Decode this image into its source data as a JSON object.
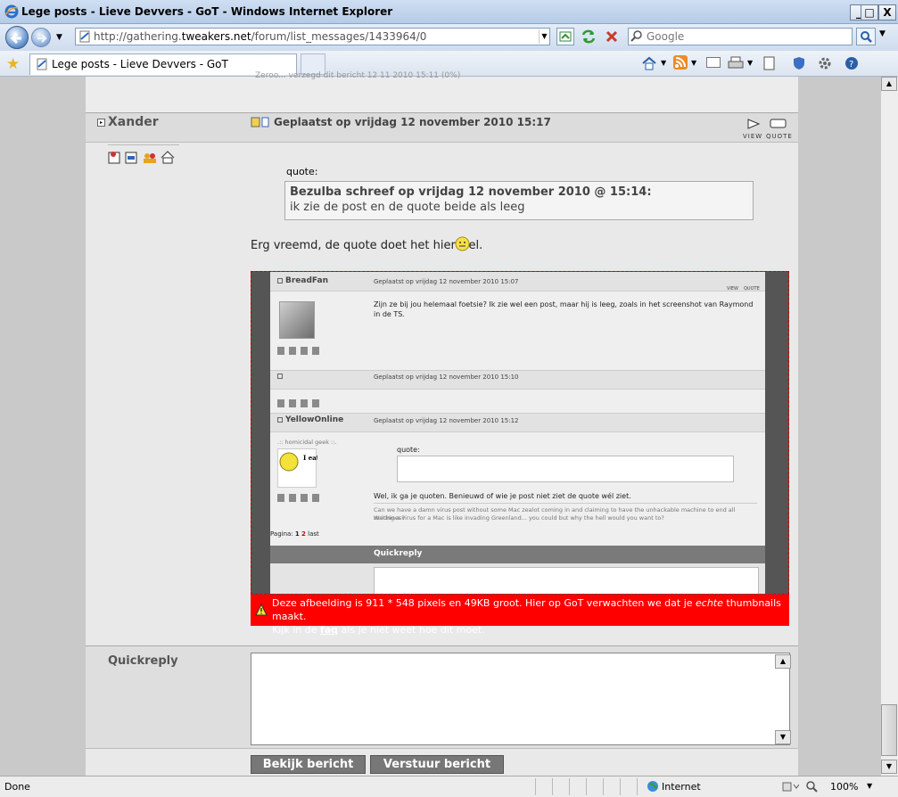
{
  "window": {
    "title": "Lege posts - Lieve Devvers - GoT - Windows Internet Explorer",
    "min": "_",
    "max": "□",
    "close": "X"
  },
  "addressbar": {
    "url_prefix": "http://gathering.",
    "url_domain": "tweakers.net",
    "url_path": "/forum/list_messages/1433964/0"
  },
  "searchbar": {
    "placeholder": "Google"
  },
  "tab": {
    "title": "Lege posts - Lieve Devvers - GoT"
  },
  "post": {
    "author": "Xander",
    "posted": "Geplaatst op vrijdag 12 november 2010 15:17",
    "view_label": "VIEW",
    "quote_label": "QUOTE",
    "quote_label_text": "quote:",
    "quote_header": "Bezulba schreef op vrijdag 12 november 2010 @ 15:14:",
    "quote_body": "ik zie de post en de quote beide als leeg",
    "message": "Erg vreemd, de quote doet het hier wel."
  },
  "screenshot": {
    "posts": [
      {
        "author": "BreadFan",
        "date": "Geplaatst op vrijdag 12 november 2010 15:07",
        "text": "Zijn ze bij jou helemaal foetsie? Ik zie wel een post, maar hij is leeg, zoals in het screenshot van Raymond in de TS."
      },
      {
        "author": "",
        "date": "Geplaatst op vrijdag 12 november 2010 15:10",
        "text": ""
      },
      {
        "author": "YellowOnline",
        "date": "Geplaatst op vrijdag 12 november 2010 15:12",
        "usertitle": ".:: homicidal geek ::.",
        "avatar_text": "I eat pussy",
        "quote_label": "quote:",
        "text": "Wel, ik ga je quoten. Benieuwd of wie je post niet ziet de quote wél ziet.",
        "sig1": "Can we have a damn virus post without some Mac zealot coming in and claiming to have the unhackable machine to end all machines?",
        "sig2": "Writing a virus for a Mac is like invading Greenland... you could but why the hell would you want to?"
      }
    ],
    "view": "VIEW",
    "quote": "QUOTE",
    "pagina": "Pagina:",
    "page1": "1",
    "page2": "2",
    "last": "last",
    "quickreply": "Quickreply",
    "partial_text": "Zeroo... verzegd dit bericht 12 11 2010 15:11 (0%)"
  },
  "warning": {
    "line1_a": "Deze afbeelding is 911 * 548 pixels en 49KB groot. Hier op GoT verwachten we dat je ",
    "line1_em": "echte",
    "line1_b": " thumbnails maakt.",
    "line2_a": "Kijk in de ",
    "line2_link": "faq",
    "line2_b": " als je niet weet hoe dit moet."
  },
  "quickreply": {
    "label": "Quickreply",
    "preview_button": "Bekijk bericht",
    "send_button": "Verstuur bericht"
  },
  "statusbar": {
    "status": "Done",
    "zone": "Internet",
    "zoom": "100%"
  },
  "colors": {
    "warning_bg": "#ff0000",
    "page_bg": "#c9c9c9",
    "content_bg": "#e9e9e9"
  }
}
